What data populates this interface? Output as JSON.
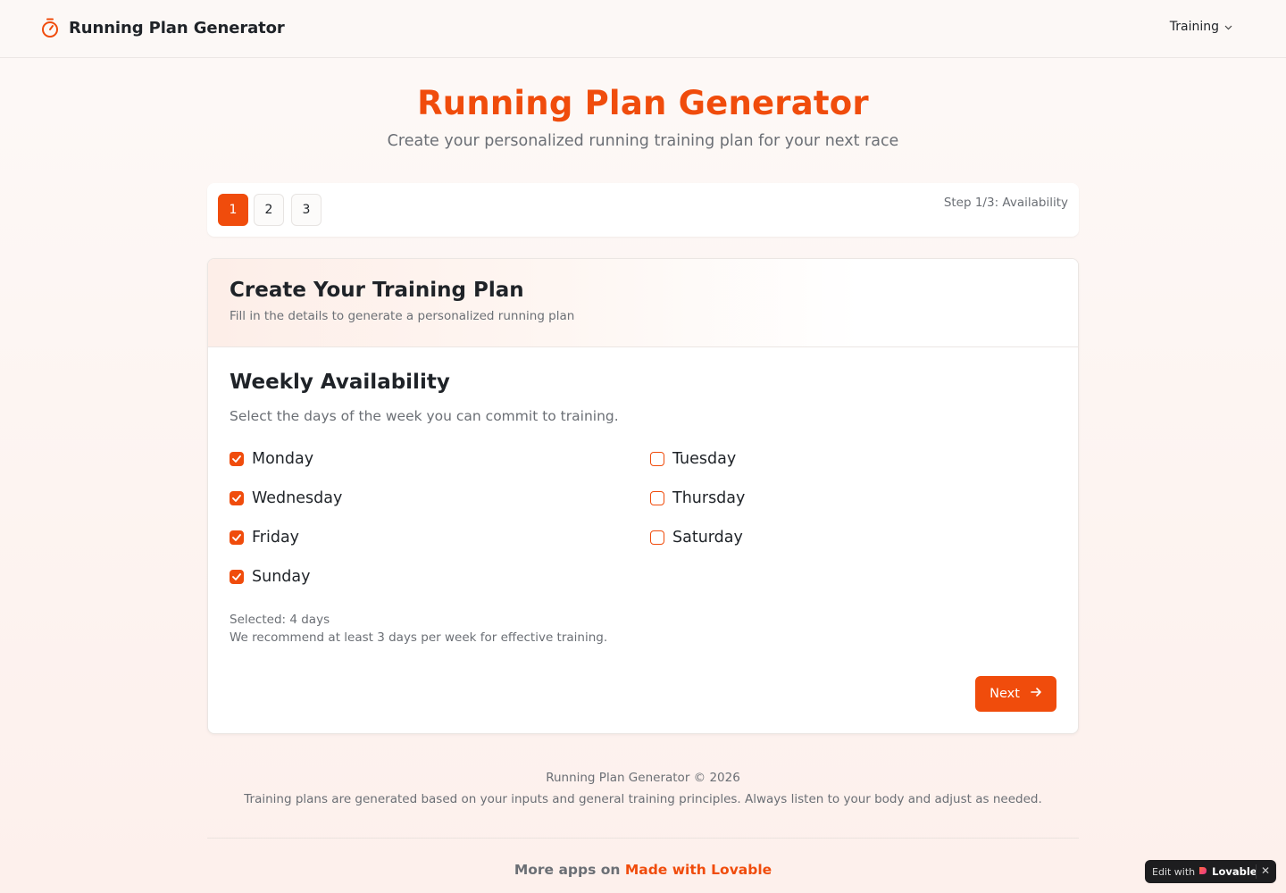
{
  "header": {
    "app_title": "Running Plan Generator",
    "nav_menu_label": "Training"
  },
  "hero": {
    "title": "Running Plan Generator",
    "subtitle": "Create your personalized running training plan for your next race"
  },
  "stepper": {
    "steps": [
      "1",
      "2",
      "3"
    ],
    "active_step": 1,
    "status_label": "Step 1/3: Availability"
  },
  "card": {
    "title": "Create Your Training Plan",
    "description": "Fill in the details to generate a personalized running plan",
    "section_title": "Weekly Availability",
    "section_description": "Select the days of the week you can commit to training.",
    "days": [
      {
        "label": "Monday",
        "checked": true
      },
      {
        "label": "Tuesday",
        "checked": false
      },
      {
        "label": "Wednesday",
        "checked": true
      },
      {
        "label": "Thursday",
        "checked": false
      },
      {
        "label": "Friday",
        "checked": true
      },
      {
        "label": "Saturday",
        "checked": false
      },
      {
        "label": "Sunday",
        "checked": true
      }
    ],
    "selected_count": "Selected: 4 days",
    "recommendation": "We recommend at least 3 days per week for effective training.",
    "next_label": "Next"
  },
  "footer": {
    "copyright": "Running Plan Generator © 2026",
    "disclaimer": "Training plans are generated based on your inputs and general training principles. Always listen to your body and adjust as needed.",
    "more_apps_prefix": "More apps on",
    "more_apps_link": "Made with Lovable"
  },
  "badge": {
    "edit_with": "Edit with",
    "brand": "Lovable"
  },
  "colors": {
    "accent": "#f04c0c",
    "muted_text": "#6b6f75",
    "text": "#1f2328"
  },
  "icons": {
    "brand": "stopwatch-icon",
    "nav_menu": "chevron-down-icon",
    "checkbox": "check-icon",
    "next": "arrow-right-icon",
    "badge_logo": "heart-icon",
    "badge_close": "close-icon"
  }
}
